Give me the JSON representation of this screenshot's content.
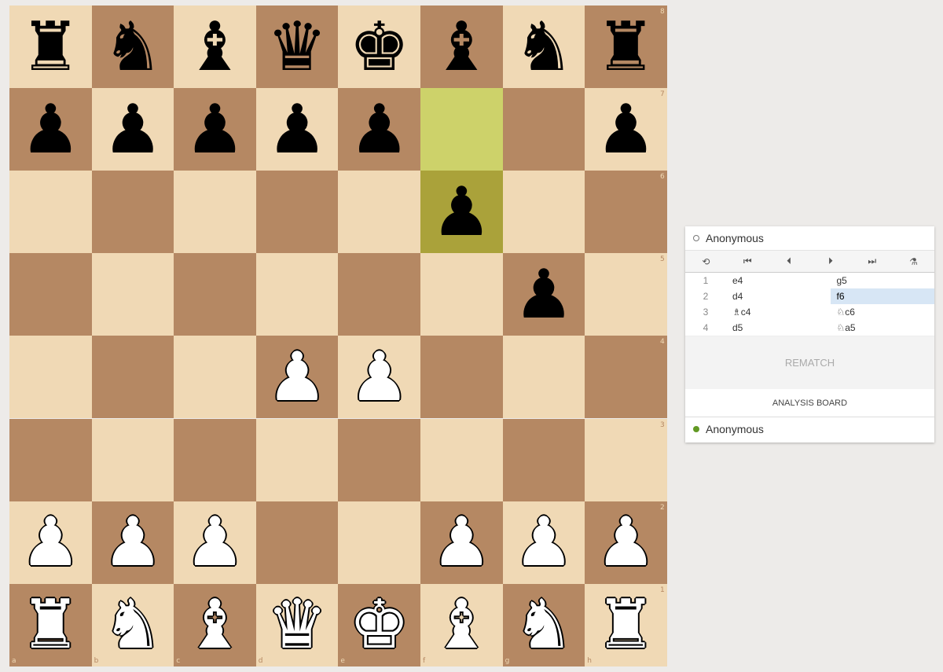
{
  "board": {
    "ranks": [
      "8",
      "7",
      "6",
      "5",
      "4",
      "3",
      "2",
      "1"
    ],
    "files": [
      "a",
      "b",
      "c",
      "d",
      "e",
      "f",
      "g",
      "h"
    ],
    "rows": [
      [
        "r",
        "n",
        "b",
        "q",
        "k",
        "b",
        "n",
        "r"
      ],
      [
        "p",
        "p",
        "p",
        "p",
        "p",
        "",
        "",
        "p"
      ],
      [
        "",
        "",
        "",
        "",
        "",
        "p",
        "",
        ""
      ],
      [
        "",
        "",
        "",
        "",
        "",
        "",
        "p",
        ""
      ],
      [
        "",
        "",
        "",
        "P",
        "P",
        "",
        "",
        ""
      ],
      [
        "",
        "",
        "",
        "",
        "",
        "",
        "",
        ""
      ],
      [
        "P",
        "P",
        "P",
        "",
        "",
        "P",
        "P",
        "P"
      ],
      [
        "R",
        "N",
        "B",
        "Q",
        "K",
        "B",
        "N",
        "R"
      ]
    ],
    "last_move": [
      "f7",
      "f6"
    ],
    "highlight_colors": {
      "light": "#cdd26a",
      "dark": "#aaa23a"
    },
    "square_colors": {
      "light": "#f0d9b5",
      "dark": "#b58863"
    }
  },
  "panel": {
    "top_player": "Anonymous",
    "bottom_player": "Anonymous",
    "bottom_status_color": "#629924",
    "controls": [
      {
        "icon": "flip-board-icon",
        "glyph": "⟲"
      },
      {
        "icon": "first-move-icon",
        "glyph": "⏮"
      },
      {
        "icon": "previous-move-icon",
        "glyph": "⏴"
      },
      {
        "icon": "next-move-icon",
        "glyph": "⏵"
      },
      {
        "icon": "last-move-icon",
        "glyph": "⏭"
      },
      {
        "icon": "analysis-icon",
        "glyph": "⚗"
      }
    ],
    "moves": [
      {
        "num": "1",
        "white": "e4",
        "black": "g5"
      },
      {
        "num": "2",
        "white": "d4",
        "black": "f6"
      },
      {
        "num": "3",
        "white": "♗c4",
        "black": "♘c6"
      },
      {
        "num": "4",
        "white": "d5",
        "black": "♘a5"
      }
    ],
    "active_move": {
      "row": 1,
      "side": "black"
    },
    "rematch_label": "REMATCH",
    "analysis_label": "ANALYSIS BOARD"
  }
}
